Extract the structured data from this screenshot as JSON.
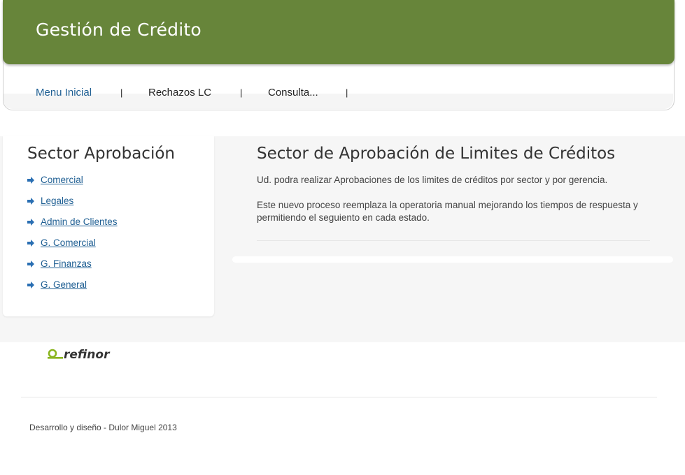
{
  "header": {
    "title": "Gestión de Crédito",
    "brand_color": "#67853a"
  },
  "nav": {
    "items": [
      {
        "label": "Menu Inicial",
        "active": true
      },
      {
        "label": "Rechazos LC",
        "active": false
      },
      {
        "label": "Consulta...",
        "active": false
      }
    ],
    "separator": "|"
  },
  "sidebar": {
    "title": "Sector Aprobación",
    "items": [
      {
        "label": "Comercial",
        "icon": "arrow-right-icon"
      },
      {
        "label": "Legales",
        "icon": "arrow-right-icon"
      },
      {
        "label": "Admin de Clientes",
        "icon": "arrow-right-icon"
      },
      {
        "label": "G. Comercial",
        "icon": "arrow-right-icon"
      },
      {
        "label": "G. Finanzas",
        "icon": "arrow-right-icon"
      },
      {
        "label": "G. General",
        "icon": "arrow-right-icon"
      }
    ],
    "arrow_color": "#2a6fb3",
    "link_color": "#1f5f93"
  },
  "main": {
    "title": "Sector de Aprobación de Limites de Créditos",
    "paragraph1": "Ud. podra realizar Aprobaciones de los limites de créditos por sector y por gerencia.",
    "paragraph2": "Este nuevo proceso reemplaza la operatoria manual mejorando los tiempos de respuesta y permitiendo el seguiento en cada estado."
  },
  "footer": {
    "logo_text": "refinor",
    "logo_color": "#8ab51f",
    "credits": "Desarrollo y diseño - Dulor Miguel 2013"
  }
}
